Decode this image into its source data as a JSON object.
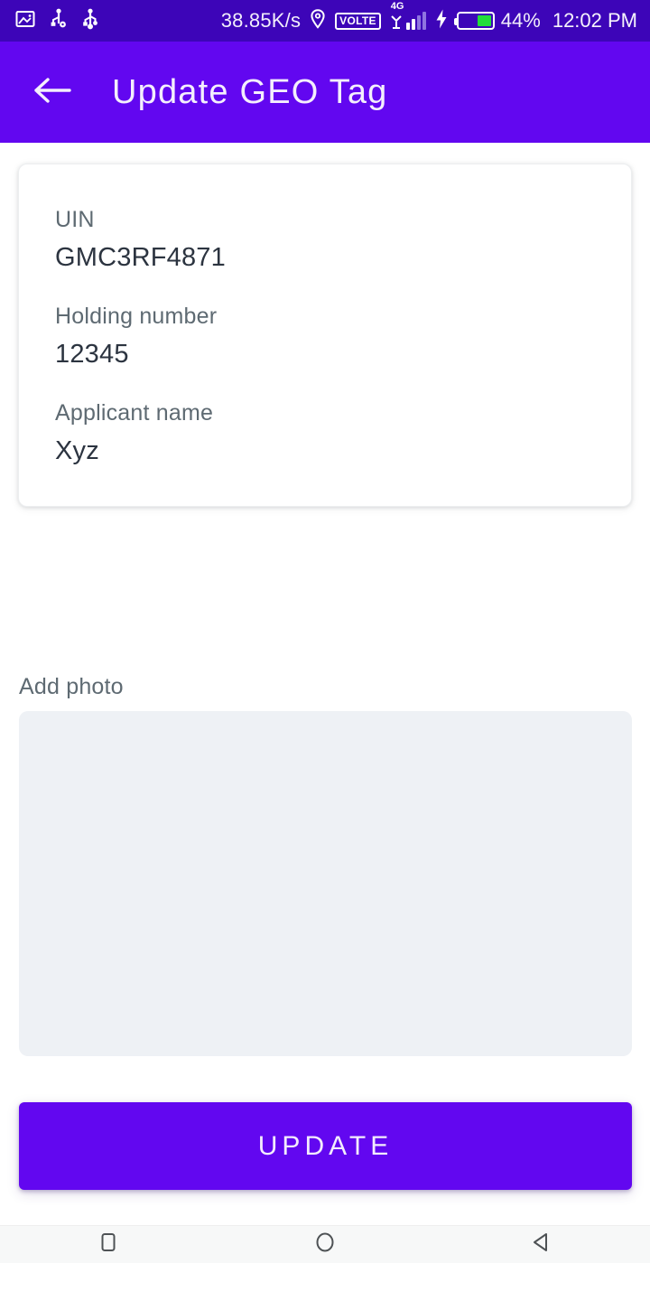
{
  "status_bar": {
    "network_speed": "38.85K/s",
    "volte_label": "VOLTE",
    "network_type": "4G",
    "battery_percent": "44%",
    "battery_level": 44,
    "time": "12:02 PM",
    "icons": [
      "screenshot-icon",
      "usb-debug-icon",
      "usb-icon",
      "location-icon",
      "volte-icon",
      "signal-icon",
      "charging-icon",
      "battery-icon"
    ],
    "background_color": "#3d05b8"
  },
  "app_bar": {
    "title": "Update GEO Tag",
    "back_icon": "arrow-left-icon",
    "background_color": "#6207f0"
  },
  "info_card": {
    "fields": [
      {
        "label": "UIN",
        "value": "GMC3RF4871"
      },
      {
        "label": "Holding number",
        "value": "12345"
      },
      {
        "label": "Applicant name",
        "value": "Xyz"
      }
    ]
  },
  "photo_section": {
    "label": "Add photo",
    "placeholder_color": "#eef1f5"
  },
  "actions": {
    "update_label": "UPDATE",
    "accent_color": "#6207f0"
  },
  "nav_bar": {
    "recents_icon": "square-icon",
    "home_icon": "circle-icon",
    "back_icon": "triangle-back-icon"
  }
}
